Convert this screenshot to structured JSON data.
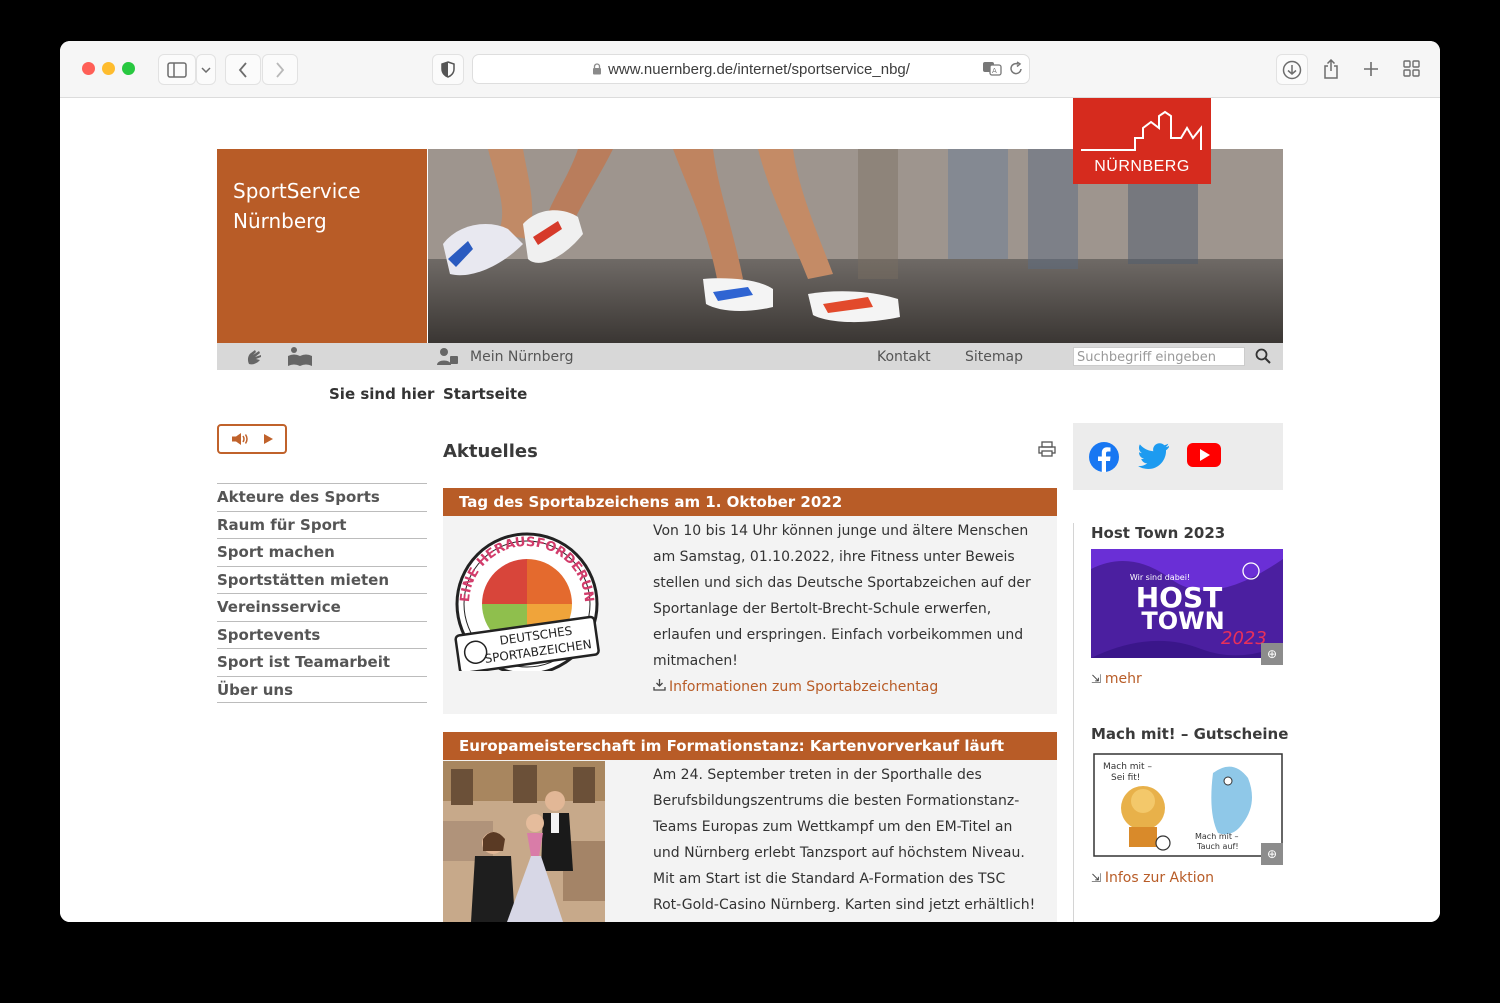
{
  "browser": {
    "url": "www.nuernberg.de/internet/sportservice_nbg/"
  },
  "header": {
    "site_title_line1": "SportService",
    "site_title_line2": "Nürnberg",
    "logo_text": "NÜRNBERG"
  },
  "utilbar": {
    "mein": "Mein Nürnberg",
    "kontakt": "Kontakt",
    "sitemap": "Sitemap",
    "search_placeholder": "Suchbegriff eingeben"
  },
  "breadcrumb": {
    "label": "Sie sind hier",
    "current": "Startseite"
  },
  "nav": {
    "items": [
      "Akteure des Sports",
      "Raum für Sport",
      "Sport machen",
      "Sportstätten mieten",
      "Vereinsservice",
      "Sportevents",
      "Sport ist Teamarbeit",
      "Über uns"
    ]
  },
  "main": {
    "heading": "Aktuelles",
    "news": [
      {
        "title": "Tag des Sportabzeichens am 1. Oktober 2022",
        "lines": [
          "Von 10 bis 14 Uhr können junge und ältere Menschen",
          "am Samstag, 01.10.2022, ihre Fitness unter Beweis",
          "stellen und sich das Deutsche Sportabzeichen auf der",
          "Sportanlage der Bertolt-Brecht-Schule erwerfen,",
          "erlaufen und erspringen. Einfach vorbeikommen und",
          "mitmachen!"
        ],
        "link": "Informationen zum Sportabzeichentag",
        "badge_arc": "DEINE HERAUSFORDERUNG",
        "badge_banner1": "DEUTSCHES",
        "badge_banner2": "SPORTABZEICHEN"
      },
      {
        "title": "Europameisterschaft im Formationstanz: Kartenvorverkauf läuft",
        "lines": [
          "Am 24. September treten in der Sporthalle des",
          "Berufsbildungszentrums die besten Formationstanz-",
          "Teams Europas zum Wettkampf um den EM-Titel an",
          "und Nürnberg erlebt Tanzsport auf höchstem Niveau.",
          "Mit am Start ist die Standard A-Formation des TSC",
          "Rot-Gold-Casino Nürnberg. Karten sind jetzt erhältlich!"
        ]
      }
    ]
  },
  "sidebar": {
    "host_town_heading": "Host Town 2023",
    "host_town_small": "Wir sind dabei!",
    "host_town_big1": "HOST",
    "host_town_big2": "TOWN",
    "host_town_year": "2023",
    "host_town_link": "mehr",
    "gutschein_heading": "Mach mit! – Gutscheine",
    "gutschein_text1": "Mach mit –",
    "gutschein_text2": "Sei fit!",
    "gutschein_text3": "Mach mit –",
    "gutschein_text4": "Tauch auf!",
    "gutschein_link": "Infos zur Aktion"
  },
  "colors": {
    "brand_orange": "#b85c27",
    "logo_red": "#d62b1e",
    "facebook": "#1877f2",
    "twitter": "#1d9bf0",
    "youtube": "#ff0000"
  }
}
